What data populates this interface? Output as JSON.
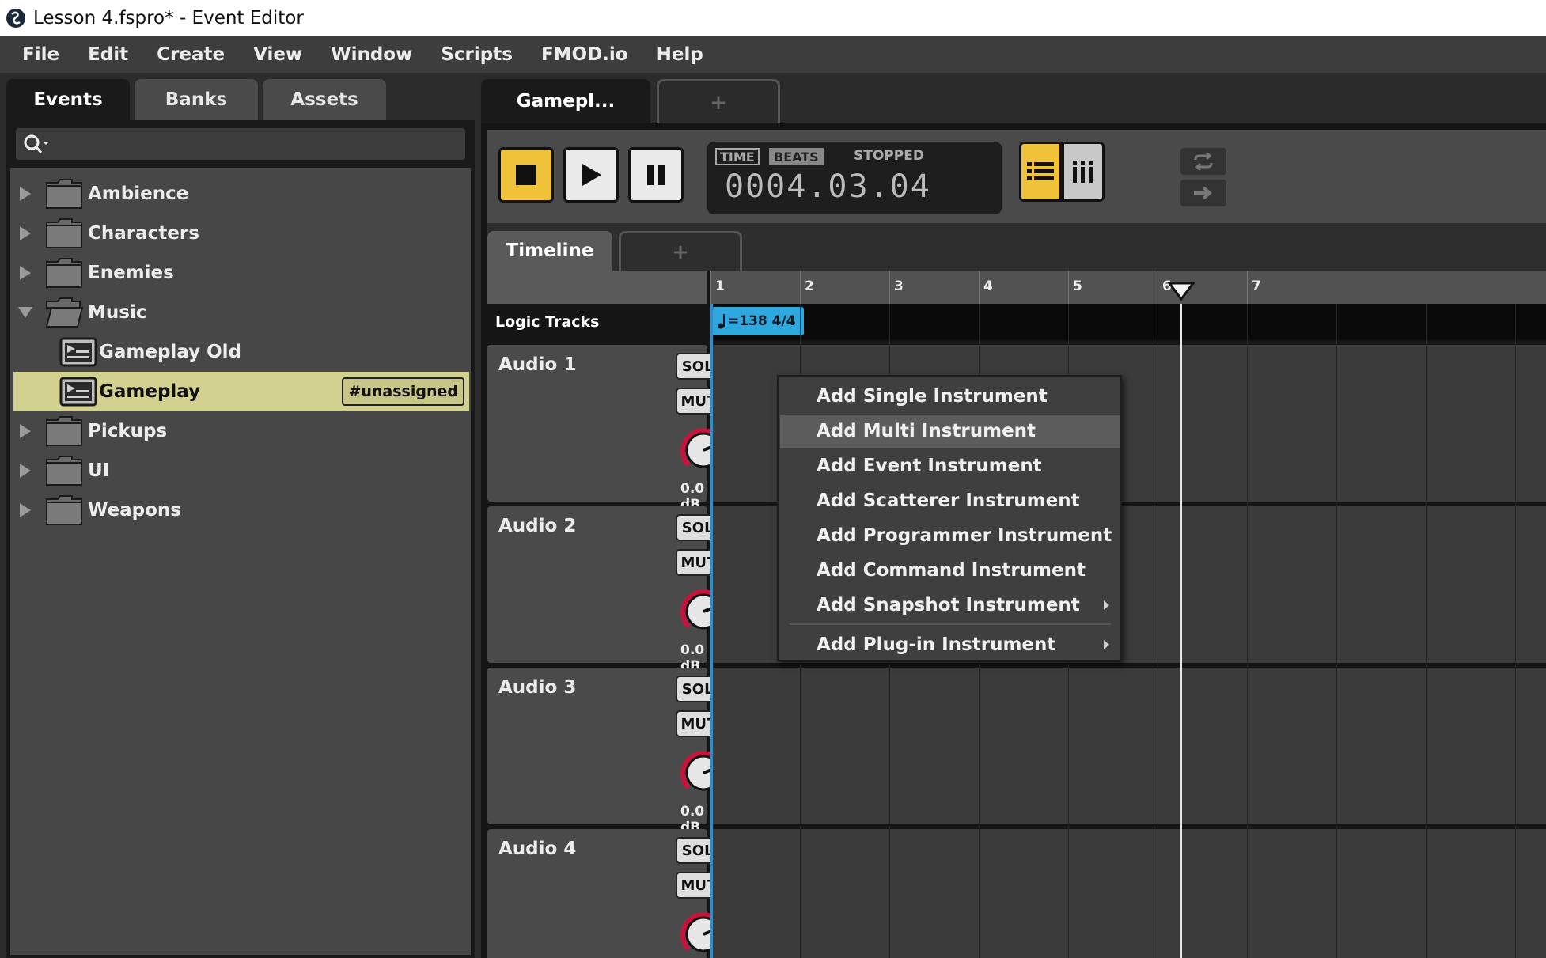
{
  "window": {
    "title": "Lesson 4.fspro* - Event Editor"
  },
  "menubar": [
    "File",
    "Edit",
    "Create",
    "View",
    "Window",
    "Scripts",
    "FMOD.io",
    "Help"
  ],
  "browser": {
    "tabs": [
      "Events",
      "Banks",
      "Assets"
    ],
    "active_tab": "Events",
    "search": {
      "value": "",
      "placeholder": ""
    },
    "tree": [
      {
        "label": "Ambience",
        "type": "folder",
        "expanded": false
      },
      {
        "label": "Characters",
        "type": "folder",
        "expanded": false
      },
      {
        "label": "Enemies",
        "type": "folder",
        "expanded": false
      },
      {
        "label": "Music",
        "type": "folder",
        "expanded": true
      },
      {
        "label": "Gameplay Old",
        "type": "event",
        "indent": 1
      },
      {
        "label": "Gameplay",
        "type": "event",
        "indent": 1,
        "selected": true,
        "tag": "#unassigned"
      },
      {
        "label": "Pickups",
        "type": "folder",
        "expanded": false
      },
      {
        "label": "UI",
        "type": "folder",
        "expanded": false
      },
      {
        "label": "Weapons",
        "type": "folder",
        "expanded": false
      }
    ]
  },
  "editor": {
    "event_tab": "Gamepl...",
    "add_tab": "+",
    "transport": {
      "time_label": "TIME",
      "beats_label": "BEATS",
      "state": "STOPPED",
      "position": "0004.03.04"
    },
    "sheet_tabs": {
      "active": "Timeline",
      "add": "+"
    },
    "ruler_marks": [
      "1",
      "2",
      "3",
      "4",
      "5",
      "6",
      "7"
    ],
    "logic_tracks_label": "Logic Tracks",
    "tempo_marker": "=138 4/4",
    "tracks": [
      {
        "name": "Audio 1",
        "solo": "SOLO",
        "mute": "MUTE",
        "volume": "0.0 dB"
      },
      {
        "name": "Audio 2",
        "solo": "SOLO",
        "mute": "MUTE",
        "volume": "0.0 dB"
      },
      {
        "name": "Audio 3",
        "solo": "SOLO",
        "mute": "MUTE",
        "volume": "0.0 dB"
      },
      {
        "name": "Audio 4",
        "solo": "SOLO",
        "mute": "MUTE",
        "volume": ""
      }
    ]
  },
  "context_menu": {
    "items": [
      {
        "label": "Add Single Instrument",
        "highlighted": false,
        "submenu": false
      },
      {
        "label": "Add Multi Instrument",
        "highlighted": true,
        "submenu": false
      },
      {
        "label": "Add Event Instrument",
        "highlighted": false,
        "submenu": false
      },
      {
        "label": "Add Scatterer Instrument",
        "highlighted": false,
        "submenu": false
      },
      {
        "label": "Add Programmer Instrument",
        "highlighted": false,
        "submenu": false
      },
      {
        "label": "Add Command Instrument",
        "highlighted": false,
        "submenu": false
      },
      {
        "label": "Add Snapshot Instrument",
        "highlighted": false,
        "submenu": true
      },
      {
        "label": "Add Plug-in Instrument",
        "highlighted": false,
        "submenu": true
      }
    ]
  },
  "colors": {
    "accent_yellow": "#f0c23a",
    "selection": "#d3d18f",
    "tempo_blue": "#2fa8e0",
    "knob_red": "#c8143c"
  }
}
